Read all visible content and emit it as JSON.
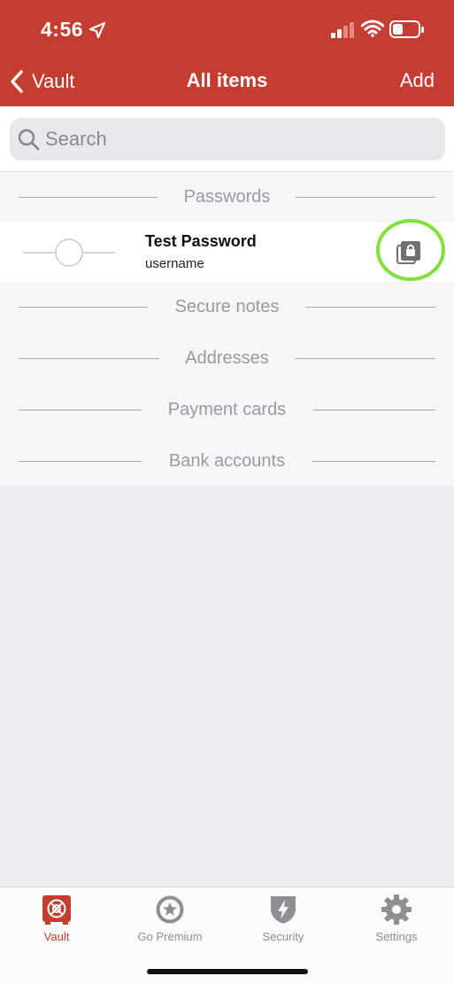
{
  "status": {
    "time": "4:56"
  },
  "nav": {
    "back_label": "Vault",
    "title": "All items",
    "add_label": "Add"
  },
  "search": {
    "placeholder": "Search"
  },
  "sections": {
    "passwords": "Passwords",
    "secure_notes": "Secure notes",
    "addresses": "Addresses",
    "payment_cards": "Payment cards",
    "bank_accounts": "Bank accounts"
  },
  "items": [
    {
      "title": "Test Password",
      "subtitle": "username",
      "action_icon": "lock-copy-icon"
    }
  ],
  "tabs": [
    {
      "label": "Vault",
      "icon": "vault-icon",
      "active": true
    },
    {
      "label": "Go Premium",
      "icon": "star-icon",
      "active": false
    },
    {
      "label": "Security",
      "icon": "shield-bolt-icon",
      "active": false
    },
    {
      "label": "Settings",
      "icon": "gear-icon",
      "active": false
    }
  ],
  "colors": {
    "brand": "#c43d30",
    "highlight": "#7ee23d",
    "tab_inactive": "#8e8e93"
  }
}
